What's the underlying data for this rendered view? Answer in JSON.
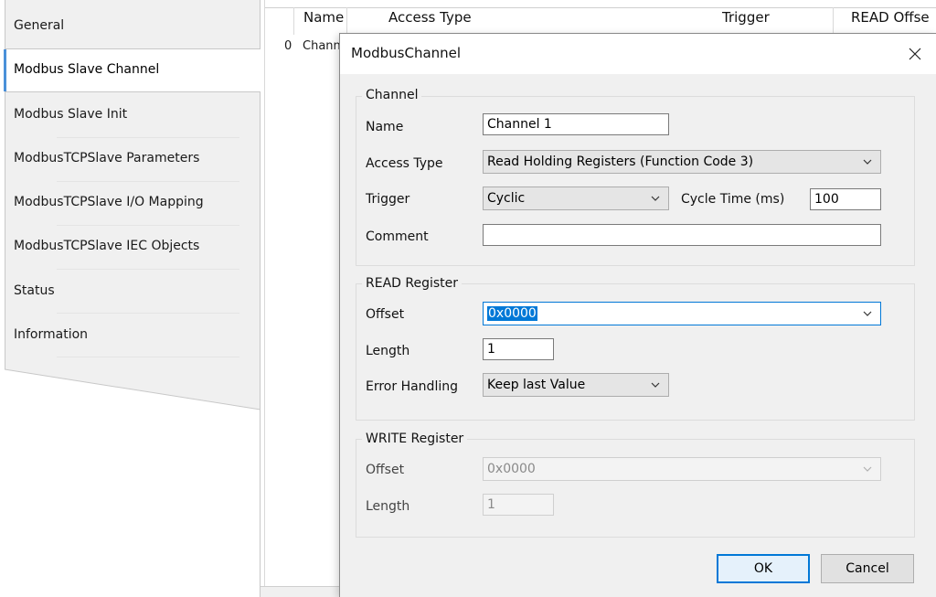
{
  "sidebar": {
    "items": [
      {
        "label": "General"
      },
      {
        "label": "Modbus Slave Channel"
      },
      {
        "label": "Modbus Slave Init"
      },
      {
        "label": "ModbusTCPSlave Parameters"
      },
      {
        "label": "ModbusTCPSlave I/O Mapping"
      },
      {
        "label": "ModbusTCPSlave IEC Objects"
      },
      {
        "label": "Status"
      },
      {
        "label": "Information"
      }
    ],
    "active_index": 1
  },
  "grid": {
    "columns": [
      "Name",
      "Access Type",
      "Trigger",
      "READ Offse"
    ],
    "rows": [
      {
        "index": "0",
        "name": "Chann"
      }
    ]
  },
  "dialog": {
    "title": "ModbusChannel",
    "close_icon": "close-icon",
    "channel": {
      "group_label": "Channel",
      "name_label": "Name",
      "name_value": "Channel 1",
      "access_type_label": "Access Type",
      "access_type_value": "Read Holding Registers (Function Code 3)",
      "trigger_label": "Trigger",
      "trigger_value": "Cyclic",
      "cycle_time_label": "Cycle Time (ms)",
      "cycle_time_value": "100",
      "comment_label": "Comment",
      "comment_value": ""
    },
    "read_register": {
      "group_label": "READ Register",
      "offset_label": "Offset",
      "offset_value": "0x0000",
      "length_label": "Length",
      "length_value": "1",
      "error_handling_label": "Error Handling",
      "error_handling_value": "Keep last Value"
    },
    "write_register": {
      "group_label": "WRITE Register",
      "offset_label": "Offset",
      "offset_value": "0x0000",
      "length_label": "Length",
      "length_value": "1"
    },
    "buttons": {
      "ok": "OK",
      "cancel": "Cancel"
    }
  },
  "colors": {
    "accent": "#0078d7",
    "dialog_bg": "#f0f0f0",
    "active_tab_border": "#4a90d9"
  }
}
